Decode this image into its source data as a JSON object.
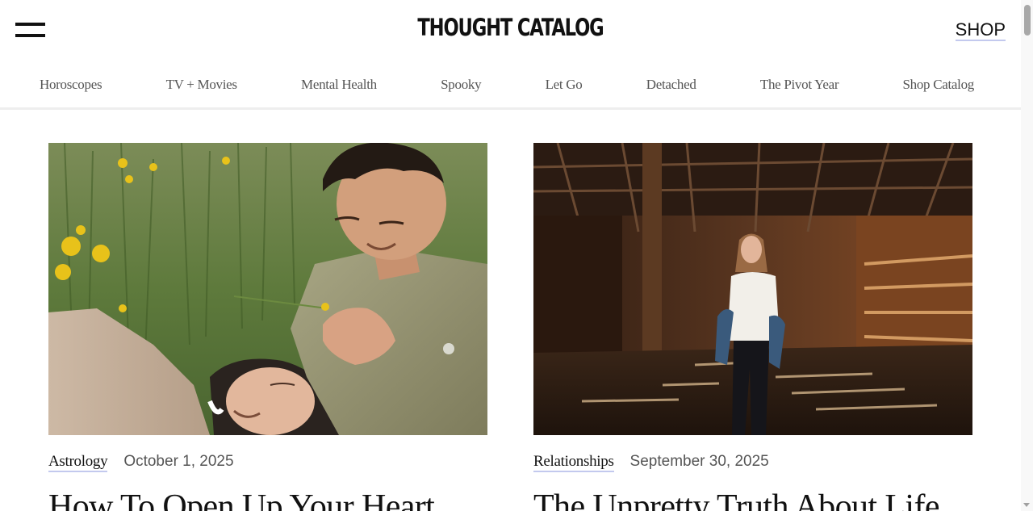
{
  "header": {
    "logo": "THOUGHT CATALOG",
    "shop_label": "SHOP"
  },
  "nav": {
    "items": [
      {
        "label": "Horoscopes"
      },
      {
        "label": "TV + Movies"
      },
      {
        "label": "Mental Health"
      },
      {
        "label": "Spooky"
      },
      {
        "label": "Let Go"
      },
      {
        "label": "Detached"
      },
      {
        "label": "The Pivot Year"
      },
      {
        "label": "Shop Catalog"
      }
    ]
  },
  "articles": [
    {
      "category": "Astrology",
      "date": "October 1, 2025",
      "title": "How To Open Up Your Heart",
      "image_desc": "couple-in-grass-photo"
    },
    {
      "category": "Relationships",
      "date": "September 30, 2025",
      "title": "The Unpretty Truth About Life",
      "image_desc": "woman-in-barn-photo"
    }
  ],
  "colors": {
    "link_underline": "#c3c9ee",
    "text": "#111111",
    "muted": "#555555"
  }
}
